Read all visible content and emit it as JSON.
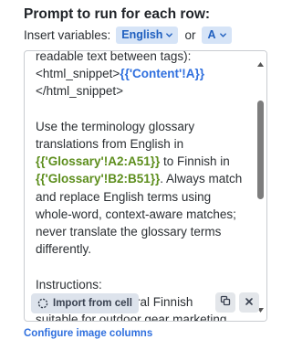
{
  "section": {
    "title": "Prompt to run for each row:",
    "insert_label": "Insert variables:",
    "or_label": "or",
    "chips": [
      "English",
      "A"
    ]
  },
  "editor": {
    "lines": {
      "l1": "readable text between tags):",
      "l2a": "<html_snippet>",
      "l2b": "{{'Content'!A}}",
      "l3": "</html_snippet>",
      "l4": "Use the terminology glossary",
      "l5": "translations from English in",
      "l6a": "{{'Glossary'!A2:A51}}",
      "l6b": " to Finnish in",
      "l7a": "{{'Glossary'!B2:B51}}",
      "l7b": ". Always match",
      "l8": "and replace English terms using",
      "l9": "whole-word, context-aware matches;",
      "l10": "never translate the glossary terms",
      "l11": "differently.",
      "l12": "Instructions:",
      "l13": "- Write fluent, natural Finnish",
      "l14": "suitable for outdoor gear marketing."
    },
    "import_label": "Import from cell"
  },
  "footer": {
    "configure_label": "Configure image columns"
  },
  "colors": {
    "accent": "#2f6fde",
    "chip_bg": "#d6e4f7",
    "variable_green": "#5d8e1d"
  },
  "icons": {
    "chip_chevron": "chevron-down-icon",
    "import": "import-circle-icon",
    "copy": "copy-icon",
    "close": "close-icon"
  }
}
